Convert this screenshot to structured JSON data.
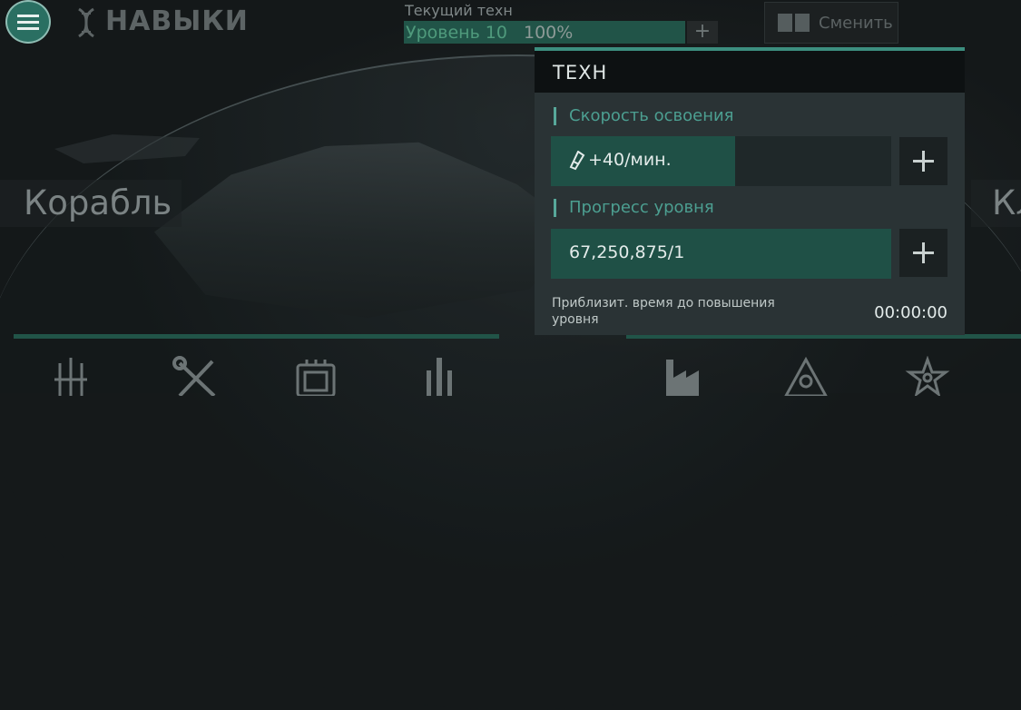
{
  "header": {
    "title": "НАВЫКИ",
    "current_tech_label": "Текущий техн",
    "current_level": "Уровень 10",
    "current_progress": "100%",
    "current_progress_fraction": 1.0,
    "add_symbol": "+",
    "swap_button_label": "Сменить",
    "menu_icon": "hamburger-menu-icon",
    "skills_icon": "dna-icon"
  },
  "carousel": {
    "left_label": "Корабль",
    "right_label": "Кл"
  },
  "popup": {
    "title": "ТЕХН",
    "speed_section_label": "Скорость освоения",
    "speed_value": "+40/мин.",
    "speed_icon": "tech-resource-icon",
    "speed_fill_fraction": 0.54,
    "progress_section_label": "Прогресс уровня",
    "progress_value": "67,250,875/1",
    "progress_fill_fraction": 1.0,
    "eta_label": "Приблизит. время до повышения уровня",
    "eta_value": "00:00:00"
  },
  "bottom_nav": {
    "icons": [
      "weapons-icon",
      "tools-icon",
      "module-icon",
      "missile-icon",
      "factory-icon",
      "crew-icon",
      "atom-star-icon"
    ]
  },
  "colors": {
    "accent": "#3c8e7f",
    "fill": "#1f5046"
  }
}
